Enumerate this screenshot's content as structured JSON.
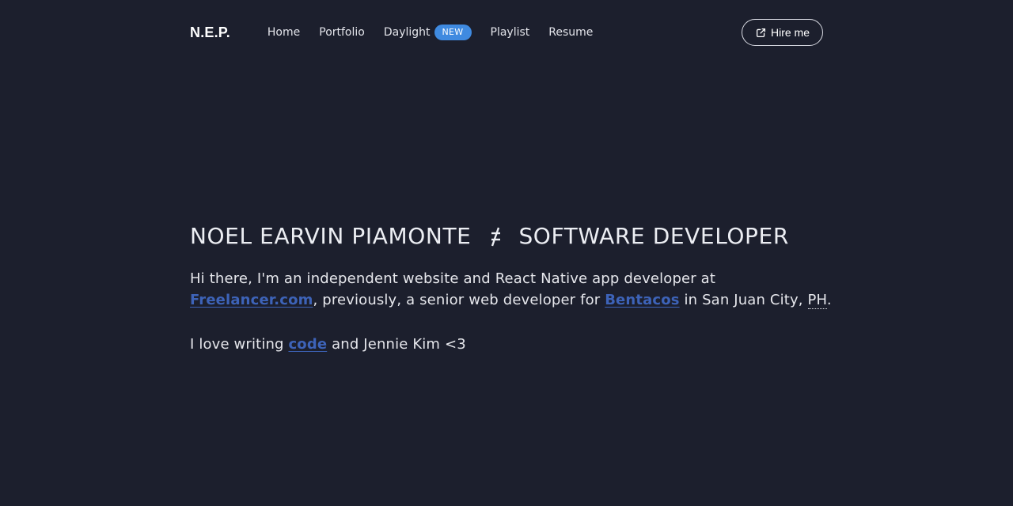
{
  "nav": {
    "brand": "N.E.P.",
    "links": [
      {
        "label": "Home"
      },
      {
        "label": "Portfolio"
      },
      {
        "label": "Daylight",
        "badge": "NEW"
      },
      {
        "label": "Playlist"
      },
      {
        "label": "Resume"
      }
    ],
    "hire_label": "Hire me",
    "hire_icon": "external-link-icon"
  },
  "hero": {
    "name": "NOEL EARVIN PIAMONTE",
    "separator": "≠",
    "role": "SOFTWARE DEVELOPER",
    "bio": {
      "part1": "Hi there, I'm an independent website and React Native app developer at ",
      "link1": "Freelancer.com",
      "part2": ", previously, a senior web developer for ",
      "link2": "Bentacos",
      "part3": " in San Juan City, ",
      "abbr": "PH",
      "part4": "."
    },
    "love": {
      "part1": "I love writing ",
      "link": "code",
      "part2": " and Jennie Kim <3"
    }
  },
  "colors": {
    "background": "#1c1f2d",
    "badge": "#3f8ae0",
    "link": "#3d63b8"
  }
}
